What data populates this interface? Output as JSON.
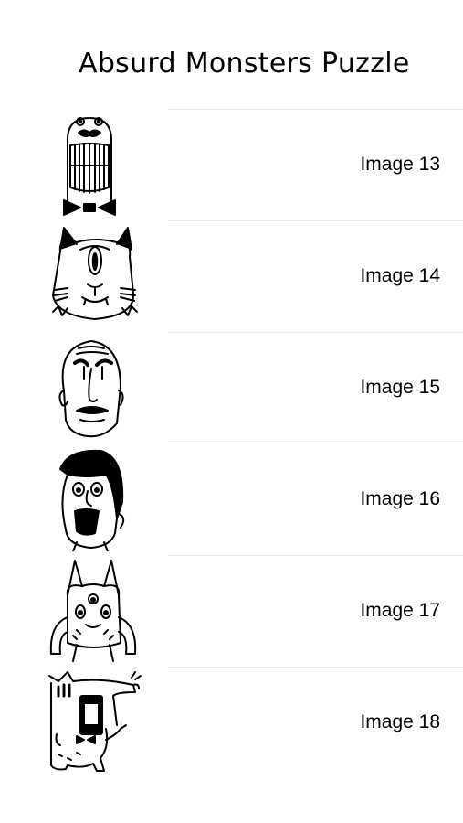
{
  "title": "Absurd Monsters Puzzle",
  "items": [
    {
      "label": "Image 13",
      "thumbnail": "smiling-bowtie-monster-icon"
    },
    {
      "label": "Image 14",
      "thumbnail": "one-eyed-cat-monster-icon"
    },
    {
      "label": "Image 15",
      "thumbnail": "bald-mustache-man-icon"
    },
    {
      "label": "Image 16",
      "thumbnail": "pompadour-man-icon"
    },
    {
      "label": "Image 17",
      "thumbnail": "horned-three-eyed-monster-icon"
    },
    {
      "label": "Image 18",
      "thumbnail": "wolf-bowtie-monster-icon"
    }
  ]
}
